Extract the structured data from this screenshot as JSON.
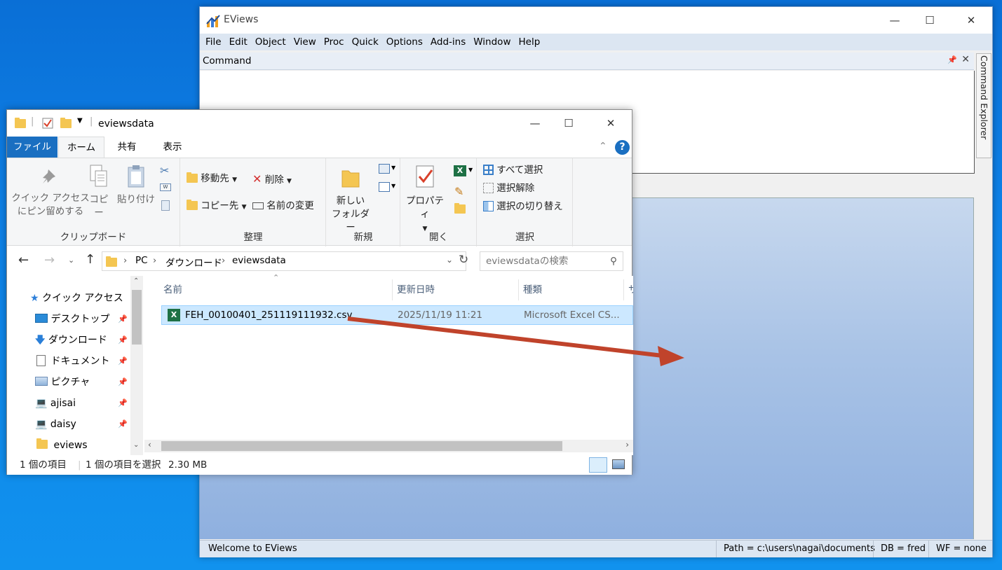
{
  "eviews": {
    "title": "EViews",
    "menu": [
      "File",
      "Edit",
      "Object",
      "View",
      "Proc",
      "Quick",
      "Options",
      "Add-ins",
      "Window",
      "Help"
    ],
    "command_label": "Command",
    "side_tab": "Command Explorer",
    "status": {
      "welcome": "Welcome to EViews",
      "path": "Path = c:\\users\\nagai\\documents",
      "db": "DB = fred",
      "wf": "WF = none"
    }
  },
  "explorer": {
    "title": "eviewsdata",
    "tabs": [
      "ファイル",
      "ホーム",
      "共有",
      "表示"
    ],
    "ribbon": {
      "quick_access_line1": "クイック アクセス",
      "quick_access_line2": "にピン留めする",
      "copy": "コピー",
      "paste": "貼り付け",
      "clipboard_group": "クリップボード",
      "move_to": "移動先",
      "copy_to": "コピー先",
      "delete": "削除",
      "rename": "名前の変更",
      "organize_group": "整理",
      "new_folder_line1": "新しい",
      "new_folder_line2": "フォルダー",
      "new_group": "新規",
      "properties": "プロパティ",
      "open_group": "開く",
      "select_all": "すべて選択",
      "select_none": "選択解除",
      "invert_selection": "選択の切り替え",
      "select_group": "選択"
    },
    "address": {
      "crumbs": [
        "PC",
        "ダウンロード",
        "eviewsdata"
      ],
      "search_placeholder": "eviewsdataの検索"
    },
    "nav": {
      "quick_access": "クイック アクセス",
      "items": [
        "デスクトップ",
        "ダウンロード",
        "ドキュメント",
        "ピクチャ",
        "ajisai",
        "daisy",
        "eviews"
      ]
    },
    "columns": [
      "名前",
      "更新日時",
      "種類",
      "サ"
    ],
    "files": [
      {
        "name": "FEH_00100401_251119111932.csv",
        "modified": "2025/11/19 11:21",
        "type": "Microsoft Excel CS..."
      }
    ],
    "status": {
      "count": "1 個の項目",
      "selected": "1 個の項目を選択",
      "size": "2.30 MB"
    }
  },
  "colors": {
    "arrow": "#c0432b",
    "selection": "#cce8ff",
    "file_tab": "#1a6fc1"
  }
}
